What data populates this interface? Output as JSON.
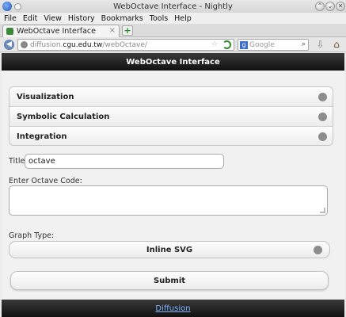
{
  "window": {
    "title": "WebOctave Interface - Nightly",
    "controls": [
      "⌃",
      "⌄",
      "✕"
    ]
  },
  "menu": [
    "File",
    "Edit",
    "View",
    "History",
    "Bookmarks",
    "Tools",
    "Help"
  ],
  "tab": {
    "label": "WebOctave Interface",
    "close": "×",
    "new_tab": "+"
  },
  "nav": {
    "url_prefix": "diffusion.",
    "url_host": "cgu.edu.tw",
    "url_suffix": "/webOctave/",
    "search_placeholder": "Google",
    "search_engine_icon": "g"
  },
  "page": {
    "header": "WebOctave Interface",
    "accordion": [
      "Visualization",
      "Symbolic Calculation",
      "Integration"
    ],
    "title_label": "Title:",
    "title_value": "octave",
    "code_label": "Enter Octave Code:",
    "graph_type_label": "Graph Type:",
    "graph_type_value": "Inline SVG",
    "submit_label": "Submit",
    "footer_link": "Diffusion"
  },
  "colors": {
    "header_bg": "#111111",
    "link": "#7fb6ff",
    "dot": "#8d8d8d"
  }
}
